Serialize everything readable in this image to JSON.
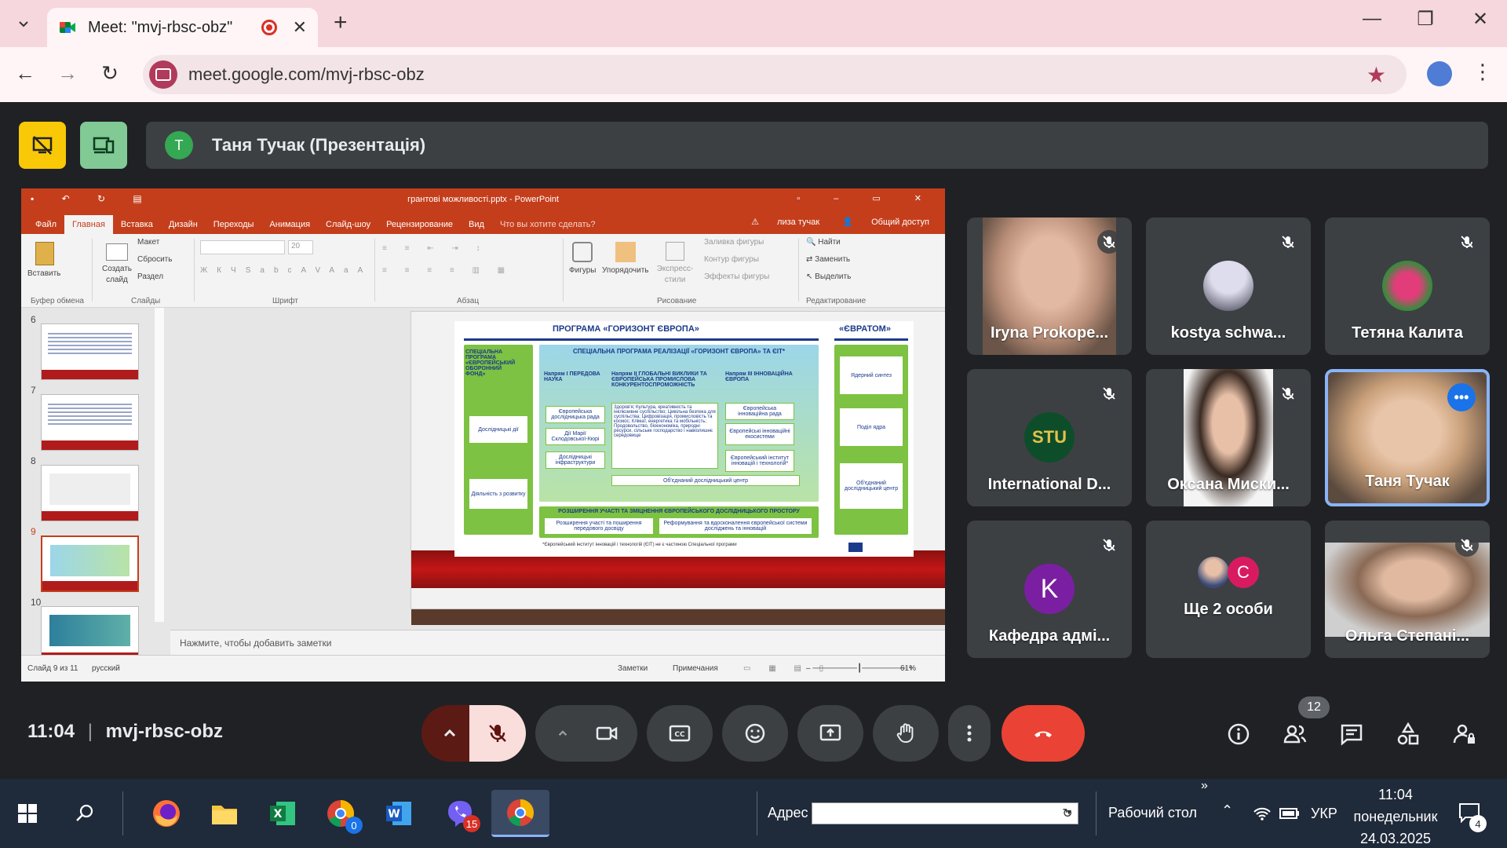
{
  "browser": {
    "tab_title": "Meet: \"mvj-rbsc-obz\"",
    "url": "meet.google.com/mvj-rbsc-obz"
  },
  "meet": {
    "presenter_initial": "T",
    "presenter_label": "Таня Тучак (Презентація)",
    "time": "11:04",
    "meeting_code": "mvj-rbsc-obz",
    "participants_count": "12",
    "participants": [
      {
        "name": "Iryna Prokope...",
        "muted": true
      },
      {
        "name": "kostya schwa...",
        "muted": true
      },
      {
        "name": "Тетяна Калита",
        "muted": true
      },
      {
        "name": "International D...",
        "muted": true
      },
      {
        "name": "Оксана Миски...",
        "muted": true
      },
      {
        "name": "Таня Тучак",
        "muted": false
      },
      {
        "name": "Кафедра адмі...",
        "initial": "K",
        "muted": true
      },
      {
        "name": "Ще 2 особи",
        "initial": "C",
        "muted": false
      },
      {
        "name": "Ольга Степані...",
        "muted": true
      }
    ],
    "colors": {
      "end_call": "#ea4335",
      "mic_off": "#f9dedc",
      "accent": "#8ab4f8"
    }
  },
  "ppt": {
    "title": "грантові можливості.pptx - PowerPoint",
    "menu": [
      "Файл",
      "Главная",
      "Вставка",
      "Дизайн",
      "Переходы",
      "Анимация",
      "Слайд-шоу",
      "Рецензирование",
      "Вид"
    ],
    "tell_me": "Что вы хотите сделать?",
    "user": "лиза тучак",
    "share": "Общий доступ",
    "ribbon": {
      "paste": "Вставить",
      "clipboard": "Буфер обмена",
      "create_slide": "Создать слайд",
      "layout": "Макет",
      "reset": "Сбросить",
      "section": "Раздел",
      "slides": "Слайды",
      "font_size": "20",
      "font": "Шрифт",
      "paragraph": "Абзац",
      "shapes": "Фигуры",
      "arrange": "Упорядочить",
      "express": "Экспресс-стили",
      "fill": "Заливка фигуры",
      "outline": "Контур фигуры",
      "effects": "Эффекты фигуры",
      "drawing": "Рисование",
      "find": "Найти",
      "replace": "Заменить",
      "select": "Выделить",
      "editing": "Редактирование"
    },
    "thumb_numbers": [
      "6",
      "7",
      "8",
      "9",
      "10"
    ],
    "notes_placeholder": "Нажмите, чтобы добавить заметки",
    "status": {
      "slide": "Слайд 9 из 11",
      "lang": "русский",
      "notes": "Заметки",
      "comments": "Примечания",
      "zoom": "61%"
    },
    "slide": {
      "title_left": "ПРОГРАМА «ГОРИЗОНТ ЄВРОПА»",
      "title_right": "«ЄВРАТОМ»",
      "special_title": "СПЕЦІАЛЬНА ПРОГРАМА РЕАЛІЗАЦІЇ «ГОРИЗОНТ ЄВРОПА» ТА ЄІТ*",
      "defence": "СПЕЦІАЛЬНА ПРОГРАМА «ЄВРОПЕЙСЬКИЙ ОБОРОННИЙ ФОНД»",
      "research": "Дослідницькі дії",
      "development": "Діяльність з розвитку",
      "pillar1": "Напрям I ПЕРЕДОВА НАУКА",
      "pillar2": "Напрям II ГЛОБАЛЬНІ ВИКЛИКИ ТА ЄВРОПЕЙСЬКА ПРОМИСЛОВА КОНКУРЕНТОСПРОМОЖНІСТЬ",
      "pillar3": "Напрям III ІННОВАЦІЙНА ЄВРОПА",
      "erc": "Європейська дослідницька рада",
      "msca": "Дії Марії Склодовської-Кюрі",
      "infra": "Дослідницькі інфраструктури",
      "eic": "Європейська інноваційна рада",
      "ecosystems": "Європейські інноваційні екосистеми",
      "eit": "Європейський інститут інновацій і технологій*",
      "clusters": "Здоров'я; Культура, креативність та інклюзивне суспільство; Цивільна безпека для суспільства; Цифровізація, промисловість та космос; Клімат, енергетика та мобільність; Продовольство, біоекономіка, природні ресурси, сільське господарство і навколишнє середовище",
      "jrc": "Об'єднаний дослідницький центр",
      "widening": "РОЗШИРЕННЯ УЧАСТІ ТА ЗМІЦНЕННЯ ЄВРОПЕЙСЬКОГО ДОСЛІДНИЦЬКОГО ПРОСТОРУ",
      "widening1": "Розширення участі та поширення передового досвіду",
      "widening2": "Реформування та вдосконалення європейської системи досліджень та інновацій",
      "fission": "Ядерний синтез",
      "fusion": "Поділ ядра",
      "jrc2": "Об'єднаний дослідницький центр",
      "footnote": "*Європейський інститут інновацій і технологій (ЄІТ) не є частиною Спеціальної програми"
    }
  },
  "taskbar": {
    "address_label": "Адрес",
    "desktop": "Рабочий стол",
    "lang": "УКР",
    "time": "11:04",
    "day": "понедельник",
    "date": "24.03.2025",
    "viber_badge": "15",
    "chrome_badge": "0",
    "notif_badge": "4"
  }
}
